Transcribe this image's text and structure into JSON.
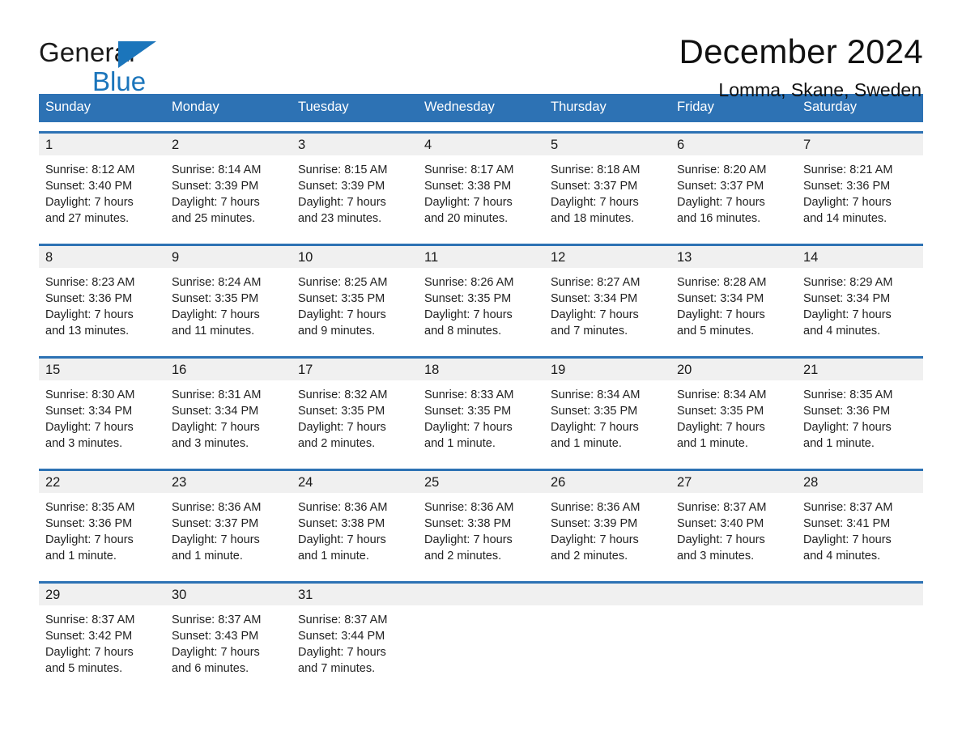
{
  "brand": {
    "name_part1": "General",
    "name_part2": "Blue",
    "triangle_color": "#1b75bb",
    "logo_icon": "triangle-icon"
  },
  "header": {
    "title": "December 2024",
    "subtitle": "Lomma, Skane, Sweden"
  },
  "colors": {
    "accent": "#2d72b4",
    "header_text": "#ffffff",
    "daynum_background": "#f0f0f0",
    "body_text": "#222222"
  },
  "calendar": {
    "day_headers": [
      "Sunday",
      "Monday",
      "Tuesday",
      "Wednesday",
      "Thursday",
      "Friday",
      "Saturday"
    ],
    "weeks": [
      [
        {
          "day": "1",
          "sunrise": "Sunrise: 8:12 AM",
          "sunset": "Sunset: 3:40 PM",
          "daylight_line1": "Daylight: 7 hours",
          "daylight_line2": "and 27 minutes."
        },
        {
          "day": "2",
          "sunrise": "Sunrise: 8:14 AM",
          "sunset": "Sunset: 3:39 PM",
          "daylight_line1": "Daylight: 7 hours",
          "daylight_line2": "and 25 minutes."
        },
        {
          "day": "3",
          "sunrise": "Sunrise: 8:15 AM",
          "sunset": "Sunset: 3:39 PM",
          "daylight_line1": "Daylight: 7 hours",
          "daylight_line2": "and 23 minutes."
        },
        {
          "day": "4",
          "sunrise": "Sunrise: 8:17 AM",
          "sunset": "Sunset: 3:38 PM",
          "daylight_line1": "Daylight: 7 hours",
          "daylight_line2": "and 20 minutes."
        },
        {
          "day": "5",
          "sunrise": "Sunrise: 8:18 AM",
          "sunset": "Sunset: 3:37 PM",
          "daylight_line1": "Daylight: 7 hours",
          "daylight_line2": "and 18 minutes."
        },
        {
          "day": "6",
          "sunrise": "Sunrise: 8:20 AM",
          "sunset": "Sunset: 3:37 PM",
          "daylight_line1": "Daylight: 7 hours",
          "daylight_line2": "and 16 minutes."
        },
        {
          "day": "7",
          "sunrise": "Sunrise: 8:21 AM",
          "sunset": "Sunset: 3:36 PM",
          "daylight_line1": "Daylight: 7 hours",
          "daylight_line2": "and 14 minutes."
        }
      ],
      [
        {
          "day": "8",
          "sunrise": "Sunrise: 8:23 AM",
          "sunset": "Sunset: 3:36 PM",
          "daylight_line1": "Daylight: 7 hours",
          "daylight_line2": "and 13 minutes."
        },
        {
          "day": "9",
          "sunrise": "Sunrise: 8:24 AM",
          "sunset": "Sunset: 3:35 PM",
          "daylight_line1": "Daylight: 7 hours",
          "daylight_line2": "and 11 minutes."
        },
        {
          "day": "10",
          "sunrise": "Sunrise: 8:25 AM",
          "sunset": "Sunset: 3:35 PM",
          "daylight_line1": "Daylight: 7 hours",
          "daylight_line2": "and 9 minutes."
        },
        {
          "day": "11",
          "sunrise": "Sunrise: 8:26 AM",
          "sunset": "Sunset: 3:35 PM",
          "daylight_line1": "Daylight: 7 hours",
          "daylight_line2": "and 8 minutes."
        },
        {
          "day": "12",
          "sunrise": "Sunrise: 8:27 AM",
          "sunset": "Sunset: 3:34 PM",
          "daylight_line1": "Daylight: 7 hours",
          "daylight_line2": "and 7 minutes."
        },
        {
          "day": "13",
          "sunrise": "Sunrise: 8:28 AM",
          "sunset": "Sunset: 3:34 PM",
          "daylight_line1": "Daylight: 7 hours",
          "daylight_line2": "and 5 minutes."
        },
        {
          "day": "14",
          "sunrise": "Sunrise: 8:29 AM",
          "sunset": "Sunset: 3:34 PM",
          "daylight_line1": "Daylight: 7 hours",
          "daylight_line2": "and 4 minutes."
        }
      ],
      [
        {
          "day": "15",
          "sunrise": "Sunrise: 8:30 AM",
          "sunset": "Sunset: 3:34 PM",
          "daylight_line1": "Daylight: 7 hours",
          "daylight_line2": "and 3 minutes."
        },
        {
          "day": "16",
          "sunrise": "Sunrise: 8:31 AM",
          "sunset": "Sunset: 3:34 PM",
          "daylight_line1": "Daylight: 7 hours",
          "daylight_line2": "and 3 minutes."
        },
        {
          "day": "17",
          "sunrise": "Sunrise: 8:32 AM",
          "sunset": "Sunset: 3:35 PM",
          "daylight_line1": "Daylight: 7 hours",
          "daylight_line2": "and 2 minutes."
        },
        {
          "day": "18",
          "sunrise": "Sunrise: 8:33 AM",
          "sunset": "Sunset: 3:35 PM",
          "daylight_line1": "Daylight: 7 hours",
          "daylight_line2": "and 1 minute."
        },
        {
          "day": "19",
          "sunrise": "Sunrise: 8:34 AM",
          "sunset": "Sunset: 3:35 PM",
          "daylight_line1": "Daylight: 7 hours",
          "daylight_line2": "and 1 minute."
        },
        {
          "day": "20",
          "sunrise": "Sunrise: 8:34 AM",
          "sunset": "Sunset: 3:35 PM",
          "daylight_line1": "Daylight: 7 hours",
          "daylight_line2": "and 1 minute."
        },
        {
          "day": "21",
          "sunrise": "Sunrise: 8:35 AM",
          "sunset": "Sunset: 3:36 PM",
          "daylight_line1": "Daylight: 7 hours",
          "daylight_line2": "and 1 minute."
        }
      ],
      [
        {
          "day": "22",
          "sunrise": "Sunrise: 8:35 AM",
          "sunset": "Sunset: 3:36 PM",
          "daylight_line1": "Daylight: 7 hours",
          "daylight_line2": "and 1 minute."
        },
        {
          "day": "23",
          "sunrise": "Sunrise: 8:36 AM",
          "sunset": "Sunset: 3:37 PM",
          "daylight_line1": "Daylight: 7 hours",
          "daylight_line2": "and 1 minute."
        },
        {
          "day": "24",
          "sunrise": "Sunrise: 8:36 AM",
          "sunset": "Sunset: 3:38 PM",
          "daylight_line1": "Daylight: 7 hours",
          "daylight_line2": "and 1 minute."
        },
        {
          "day": "25",
          "sunrise": "Sunrise: 8:36 AM",
          "sunset": "Sunset: 3:38 PM",
          "daylight_line1": "Daylight: 7 hours",
          "daylight_line2": "and 2 minutes."
        },
        {
          "day": "26",
          "sunrise": "Sunrise: 8:36 AM",
          "sunset": "Sunset: 3:39 PM",
          "daylight_line1": "Daylight: 7 hours",
          "daylight_line2": "and 2 minutes."
        },
        {
          "day": "27",
          "sunrise": "Sunrise: 8:37 AM",
          "sunset": "Sunset: 3:40 PM",
          "daylight_line1": "Daylight: 7 hours",
          "daylight_line2": "and 3 minutes."
        },
        {
          "day": "28",
          "sunrise": "Sunrise: 8:37 AM",
          "sunset": "Sunset: 3:41 PM",
          "daylight_line1": "Daylight: 7 hours",
          "daylight_line2": "and 4 minutes."
        }
      ],
      [
        {
          "day": "29",
          "sunrise": "Sunrise: 8:37 AM",
          "sunset": "Sunset: 3:42 PM",
          "daylight_line1": "Daylight: 7 hours",
          "daylight_line2": "and 5 minutes."
        },
        {
          "day": "30",
          "sunrise": "Sunrise: 8:37 AM",
          "sunset": "Sunset: 3:43 PM",
          "daylight_line1": "Daylight: 7 hours",
          "daylight_line2": "and 6 minutes."
        },
        {
          "day": "31",
          "sunrise": "Sunrise: 8:37 AM",
          "sunset": "Sunset: 3:44 PM",
          "daylight_line1": "Daylight: 7 hours",
          "daylight_line2": "and 7 minutes."
        },
        {
          "day": "",
          "sunrise": "",
          "sunset": "",
          "daylight_line1": "",
          "daylight_line2": ""
        },
        {
          "day": "",
          "sunrise": "",
          "sunset": "",
          "daylight_line1": "",
          "daylight_line2": ""
        },
        {
          "day": "",
          "sunrise": "",
          "sunset": "",
          "daylight_line1": "",
          "daylight_line2": ""
        },
        {
          "day": "",
          "sunrise": "",
          "sunset": "",
          "daylight_line1": "",
          "daylight_line2": ""
        }
      ]
    ]
  }
}
